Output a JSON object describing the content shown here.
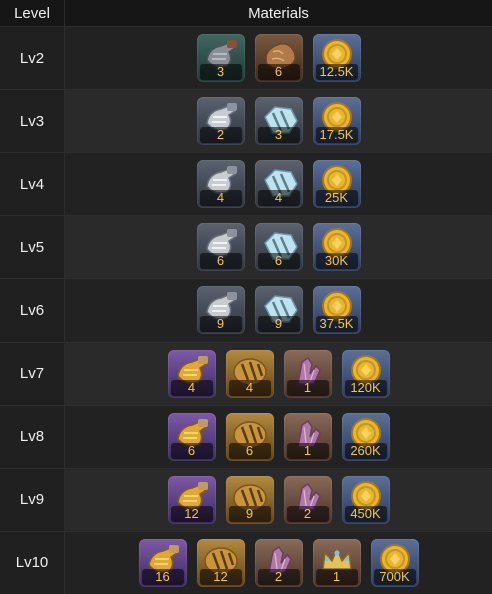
{
  "header": {
    "level": "Level",
    "materials": "Materials"
  },
  "rows": [
    {
      "level": "Lv2",
      "items": [
        {
          "icon": "iron-vessel-icon",
          "bg": "teal",
          "qty": "3"
        },
        {
          "icon": "bronze-nugget-icon",
          "bg": "brown",
          "qty": "6"
        },
        {
          "icon": "gold-coin-icon",
          "bg": "blue",
          "qty": "12.5K"
        }
      ]
    },
    {
      "level": "Lv3",
      "items": [
        {
          "icon": "silver-vessel-icon",
          "bg": "gray",
          "qty": "2"
        },
        {
          "icon": "crystal-ore-icon",
          "bg": "gray",
          "qty": "3"
        },
        {
          "icon": "gold-coin-icon",
          "bg": "blue",
          "qty": "17.5K"
        }
      ]
    },
    {
      "level": "Lv4",
      "items": [
        {
          "icon": "silver-vessel-icon",
          "bg": "gray",
          "qty": "4"
        },
        {
          "icon": "crystal-ore-icon",
          "bg": "gray",
          "qty": "4"
        },
        {
          "icon": "gold-coin-icon",
          "bg": "blue",
          "qty": "25K"
        }
      ]
    },
    {
      "level": "Lv5",
      "items": [
        {
          "icon": "silver-vessel-icon",
          "bg": "gray",
          "qty": "6"
        },
        {
          "icon": "crystal-ore-icon",
          "bg": "gray",
          "qty": "6"
        },
        {
          "icon": "gold-coin-icon",
          "bg": "blue",
          "qty": "30K"
        }
      ]
    },
    {
      "level": "Lv6",
      "items": [
        {
          "icon": "silver-vessel-icon",
          "bg": "gray",
          "qty": "9"
        },
        {
          "icon": "crystal-ore-icon",
          "bg": "gray",
          "qty": "9"
        },
        {
          "icon": "gold-coin-icon",
          "bg": "blue",
          "qty": "37.5K"
        }
      ]
    },
    {
      "level": "Lv7",
      "items": [
        {
          "icon": "golden-vessel-icon",
          "bg": "purple",
          "qty": "4"
        },
        {
          "icon": "golden-ore-icon",
          "bg": "gold",
          "qty": "4"
        },
        {
          "icon": "purple-crystal-icon",
          "bg": "copper",
          "qty": "1"
        },
        {
          "icon": "gold-coin-icon",
          "bg": "blue",
          "qty": "120K"
        }
      ]
    },
    {
      "level": "Lv8",
      "items": [
        {
          "icon": "golden-vessel-icon",
          "bg": "purple",
          "qty": "6"
        },
        {
          "icon": "golden-ore-icon",
          "bg": "gold",
          "qty": "6"
        },
        {
          "icon": "purple-crystal-icon",
          "bg": "copper",
          "qty": "1"
        },
        {
          "icon": "gold-coin-icon",
          "bg": "blue",
          "qty": "260K"
        }
      ]
    },
    {
      "level": "Lv9",
      "items": [
        {
          "icon": "golden-vessel-icon",
          "bg": "purple",
          "qty": "12"
        },
        {
          "icon": "golden-ore-icon",
          "bg": "gold",
          "qty": "9"
        },
        {
          "icon": "purple-crystal-icon",
          "bg": "copper",
          "qty": "2"
        },
        {
          "icon": "gold-coin-icon",
          "bg": "blue",
          "qty": "450K"
        }
      ]
    },
    {
      "level": "Lv10",
      "items": [
        {
          "icon": "golden-vessel-icon",
          "bg": "purple",
          "qty": "16"
        },
        {
          "icon": "golden-ore-icon",
          "bg": "gold",
          "qty": "12"
        },
        {
          "icon": "purple-crystal-icon",
          "bg": "copper",
          "qty": "2"
        },
        {
          "icon": "crown-icon",
          "bg": "copper",
          "qty": "1"
        },
        {
          "icon": "gold-coin-icon",
          "bg": "blue",
          "qty": "700K"
        }
      ]
    }
  ]
}
